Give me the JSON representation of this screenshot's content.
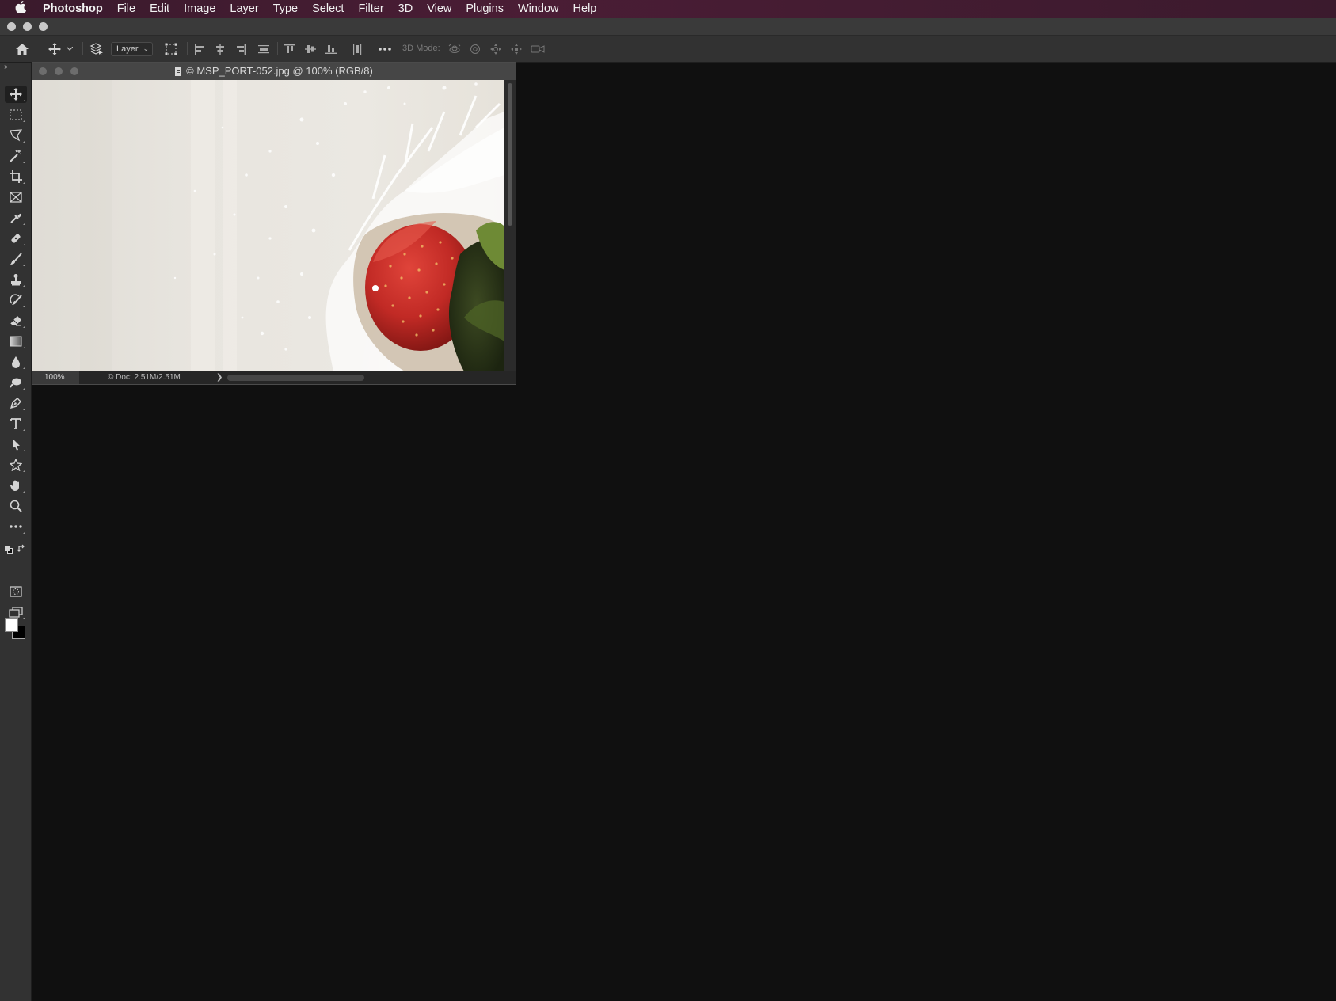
{
  "menubar": {
    "app_name": "Photoshop",
    "items": [
      {
        "label": "File"
      },
      {
        "label": "Edit"
      },
      {
        "label": "Image"
      },
      {
        "label": "Layer"
      },
      {
        "label": "Type"
      },
      {
        "label": "Select"
      },
      {
        "label": "Filter"
      },
      {
        "label": "3D"
      },
      {
        "label": "View"
      },
      {
        "label": "Plugins"
      },
      {
        "label": "Window"
      },
      {
        "label": "Help"
      }
    ]
  },
  "options_bar": {
    "auto_select_target": "Layer",
    "mode_label": "3D Mode:"
  },
  "colors": {
    "foreground": "#ffffff",
    "background": "#000000",
    "menubar_bg": "#4a1d35",
    "workspace_bg": "#101010",
    "panel_bg": "#323232"
  },
  "document": {
    "title": "© MSP_PORT-052.jpg @ 100% (RGB/8)",
    "zoom": "100%",
    "doc_info": "© Doc: 2.51M/2.51M",
    "status_arrow": "❯"
  },
  "tools": [
    {
      "name": "move-tool",
      "active": true
    },
    {
      "name": "rectangular-marquee-tool"
    },
    {
      "name": "polygonal-lasso-tool"
    },
    {
      "name": "magic-wand-tool"
    },
    {
      "name": "crop-tool"
    },
    {
      "name": "frame-tool"
    },
    {
      "name": "eyedropper-tool"
    },
    {
      "name": "healing-brush-tool"
    },
    {
      "name": "brush-tool"
    },
    {
      "name": "clone-stamp-tool"
    },
    {
      "name": "history-brush-tool"
    },
    {
      "name": "eraser-tool"
    },
    {
      "name": "gradient-tool"
    },
    {
      "name": "blur-tool"
    },
    {
      "name": "dodge-tool"
    },
    {
      "name": "pen-tool"
    },
    {
      "name": "type-tool"
    },
    {
      "name": "path-selection-tool"
    },
    {
      "name": "custom-shape-tool"
    },
    {
      "name": "hand-tool"
    },
    {
      "name": "zoom-tool"
    },
    {
      "name": "edit-toolbar"
    }
  ]
}
